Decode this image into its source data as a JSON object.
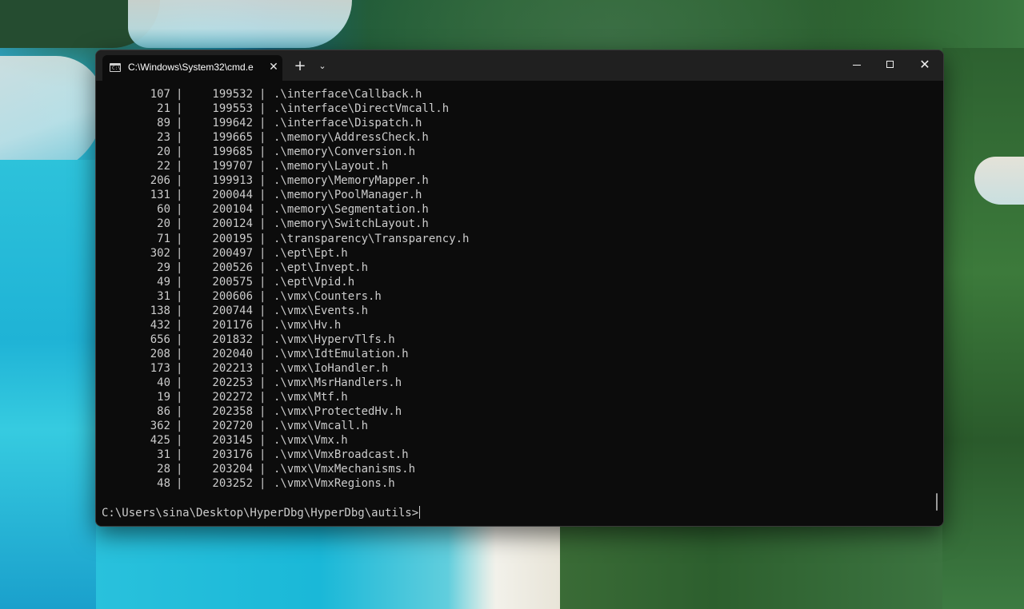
{
  "window": {
    "tab_title": "C:\\Windows\\System32\\cmd.e",
    "tab_close_glyph": "✕",
    "newtab_glyph": "+",
    "dropdown_glyph": "⌄",
    "close_glyph": "✕",
    "cmd_icon_glyph": "C:\\"
  },
  "terminal": {
    "rows": [
      {
        "lines": "107",
        "total": "199532",
        "file": ".\\interface\\Callback.h"
      },
      {
        "lines": "21",
        "total": "199553",
        "file": ".\\interface\\DirectVmcall.h"
      },
      {
        "lines": "89",
        "total": "199642",
        "file": ".\\interface\\Dispatch.h"
      },
      {
        "lines": "23",
        "total": "199665",
        "file": ".\\memory\\AddressCheck.h"
      },
      {
        "lines": "20",
        "total": "199685",
        "file": ".\\memory\\Conversion.h"
      },
      {
        "lines": "22",
        "total": "199707",
        "file": ".\\memory\\Layout.h"
      },
      {
        "lines": "206",
        "total": "199913",
        "file": ".\\memory\\MemoryMapper.h"
      },
      {
        "lines": "131",
        "total": "200044",
        "file": ".\\memory\\PoolManager.h"
      },
      {
        "lines": "60",
        "total": "200104",
        "file": ".\\memory\\Segmentation.h"
      },
      {
        "lines": "20",
        "total": "200124",
        "file": ".\\memory\\SwitchLayout.h"
      },
      {
        "lines": "71",
        "total": "200195",
        "file": ".\\transparency\\Transparency.h"
      },
      {
        "lines": "302",
        "total": "200497",
        "file": ".\\ept\\Ept.h"
      },
      {
        "lines": "29",
        "total": "200526",
        "file": ".\\ept\\Invept.h"
      },
      {
        "lines": "49",
        "total": "200575",
        "file": ".\\ept\\Vpid.h"
      },
      {
        "lines": "31",
        "total": "200606",
        "file": ".\\vmx\\Counters.h"
      },
      {
        "lines": "138",
        "total": "200744",
        "file": ".\\vmx\\Events.h"
      },
      {
        "lines": "432",
        "total": "201176",
        "file": ".\\vmx\\Hv.h"
      },
      {
        "lines": "656",
        "total": "201832",
        "file": ".\\vmx\\HypervTlfs.h"
      },
      {
        "lines": "208",
        "total": "202040",
        "file": ".\\vmx\\IdtEmulation.h"
      },
      {
        "lines": "173",
        "total": "202213",
        "file": ".\\vmx\\IoHandler.h"
      },
      {
        "lines": "40",
        "total": "202253",
        "file": ".\\vmx\\MsrHandlers.h"
      },
      {
        "lines": "19",
        "total": "202272",
        "file": ".\\vmx\\Mtf.h"
      },
      {
        "lines": "86",
        "total": "202358",
        "file": ".\\vmx\\ProtectedHv.h"
      },
      {
        "lines": "362",
        "total": "202720",
        "file": ".\\vmx\\Vmcall.h"
      },
      {
        "lines": "425",
        "total": "203145",
        "file": ".\\vmx\\Vmx.h"
      },
      {
        "lines": "31",
        "total": "203176",
        "file": ".\\vmx\\VmxBroadcast.h"
      },
      {
        "lines": "28",
        "total": "203204",
        "file": ".\\vmx\\VmxMechanisms.h"
      },
      {
        "lines": "48",
        "total": "203252",
        "file": ".\\vmx\\VmxRegions.h"
      }
    ],
    "separator": "|",
    "prompt": "C:\\Users\\sina\\Desktop\\HyperDbg\\HyperDbg\\autils>"
  },
  "colors": {
    "terminal_bg": "#0c0c0c",
    "terminal_text": "#cccccc",
    "titlebar_bg": "#202020",
    "annotation": "#d21f1f"
  }
}
